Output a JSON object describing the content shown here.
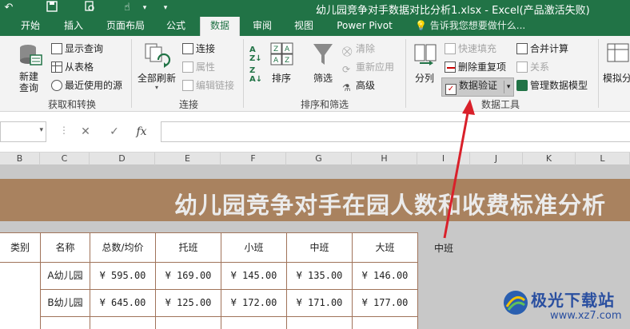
{
  "window": {
    "title": "幼儿园竞争对手数据对比分析1.xlsx - Excel(产品激活失败)"
  },
  "tabs": [
    "开始",
    "插入",
    "页面布局",
    "公式",
    "数据",
    "审阅",
    "视图",
    "Power Pivot"
  ],
  "active_tab": "数据",
  "tell_me": "告诉我您想要做什么...",
  "ribbon": {
    "get_transform": {
      "label": "获取和转换",
      "new_query": "新建\n查询",
      "show_query": "显示查询",
      "from_table": "从表格",
      "recent_sources": "最近使用的源"
    },
    "connections": {
      "label": "连接",
      "refresh_all": "全部刷新",
      "connections": "连接",
      "properties": "属性",
      "edit_links": "编辑链接"
    },
    "sort_filter": {
      "label": "排序和筛选",
      "sort": "排序",
      "filter": "筛选",
      "clear": "清除",
      "reapply": "重新应用",
      "advanced": "高级"
    },
    "data_tools": {
      "label": "数据工具",
      "text_to_columns": "分列",
      "flash_fill": "快速填充",
      "remove_duplicates": "删除重复项",
      "data_validation": "数据验证",
      "consolidate": "合并计算",
      "relationships": "关系",
      "manage_data_model": "管理数据模型"
    },
    "forecast": {
      "what_if": "模拟分"
    }
  },
  "formula_bar": {
    "fx": "fx",
    "cancel": "✕",
    "enter": "✓"
  },
  "columns": [
    "B",
    "C",
    "D",
    "E",
    "F",
    "G",
    "H",
    "I",
    "J",
    "K",
    "L"
  ],
  "sheet": {
    "banner_title": "幼儿园竞争对手在园人数和收费标准分析",
    "headers": [
      "类别",
      "名称",
      "总数/均价",
      "托班",
      "小班",
      "中班",
      "大班"
    ],
    "extra_header": "中班",
    "rows": [
      {
        "name": "A幼儿园",
        "values": [
          "¥ 595.00",
          "¥ 169.00",
          "¥ 145.00",
          "¥ 135.00",
          "¥ 146.00"
        ]
      },
      {
        "name": "B幼儿园",
        "values": [
          "¥ 645.00",
          "¥ 125.00",
          "¥ 172.00",
          "¥ 171.00",
          "¥ 177.00"
        ]
      }
    ]
  },
  "watermark": {
    "text": "极光下载站",
    "url": "www.xz7.com"
  },
  "colors": {
    "excel_green": "#217346",
    "banner_brown": "#a9825f",
    "arrow_red": "#d9202a"
  }
}
